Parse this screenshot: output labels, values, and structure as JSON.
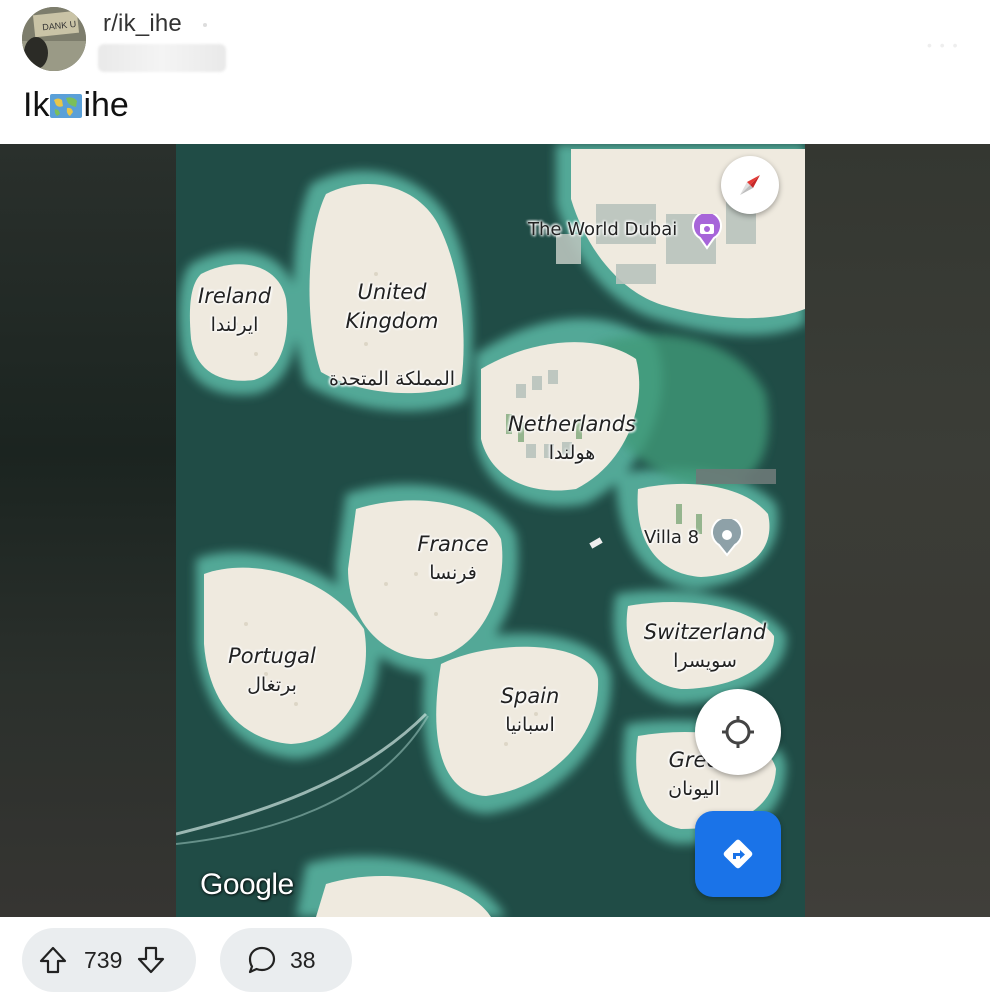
{
  "post": {
    "subreddit": "r/ik_ihe",
    "avatar_label": "DANK U",
    "title_before": "Ik",
    "title_icon": "world-map-emoji",
    "title_after": "ihe"
  },
  "map": {
    "labels": [
      {
        "en": "Ireland",
        "ar": "ايرلندا"
      },
      {
        "en": "United\nKingdom",
        "ar": "المملكة المتحدة"
      },
      {
        "en": "Netherlands",
        "ar": "هولندا"
      },
      {
        "en": "France",
        "ar": "فرنسا"
      },
      {
        "en": "Portugal",
        "ar": "برتغال"
      },
      {
        "en": "Spain",
        "ar": "اسبانيا"
      },
      {
        "en": "Switzerland",
        "ar": "سويسرا"
      },
      {
        "en": "Gree",
        "ar": "اليونان"
      }
    ],
    "poi_world": "The World Dubai",
    "poi_villa": "Villa 8",
    "watermark": "Google",
    "icons": {
      "compass": "compass-icon",
      "locate": "my-location-icon",
      "directions": "directions-icon",
      "poi": "camera-pin-icon",
      "villa": "location-pin-icon"
    },
    "colors": {
      "water": "#1f4b43",
      "sand": "#f1ece0",
      "directions": "#1a73e8"
    }
  },
  "actions": {
    "vote_count": "739",
    "comment_count": "38"
  }
}
